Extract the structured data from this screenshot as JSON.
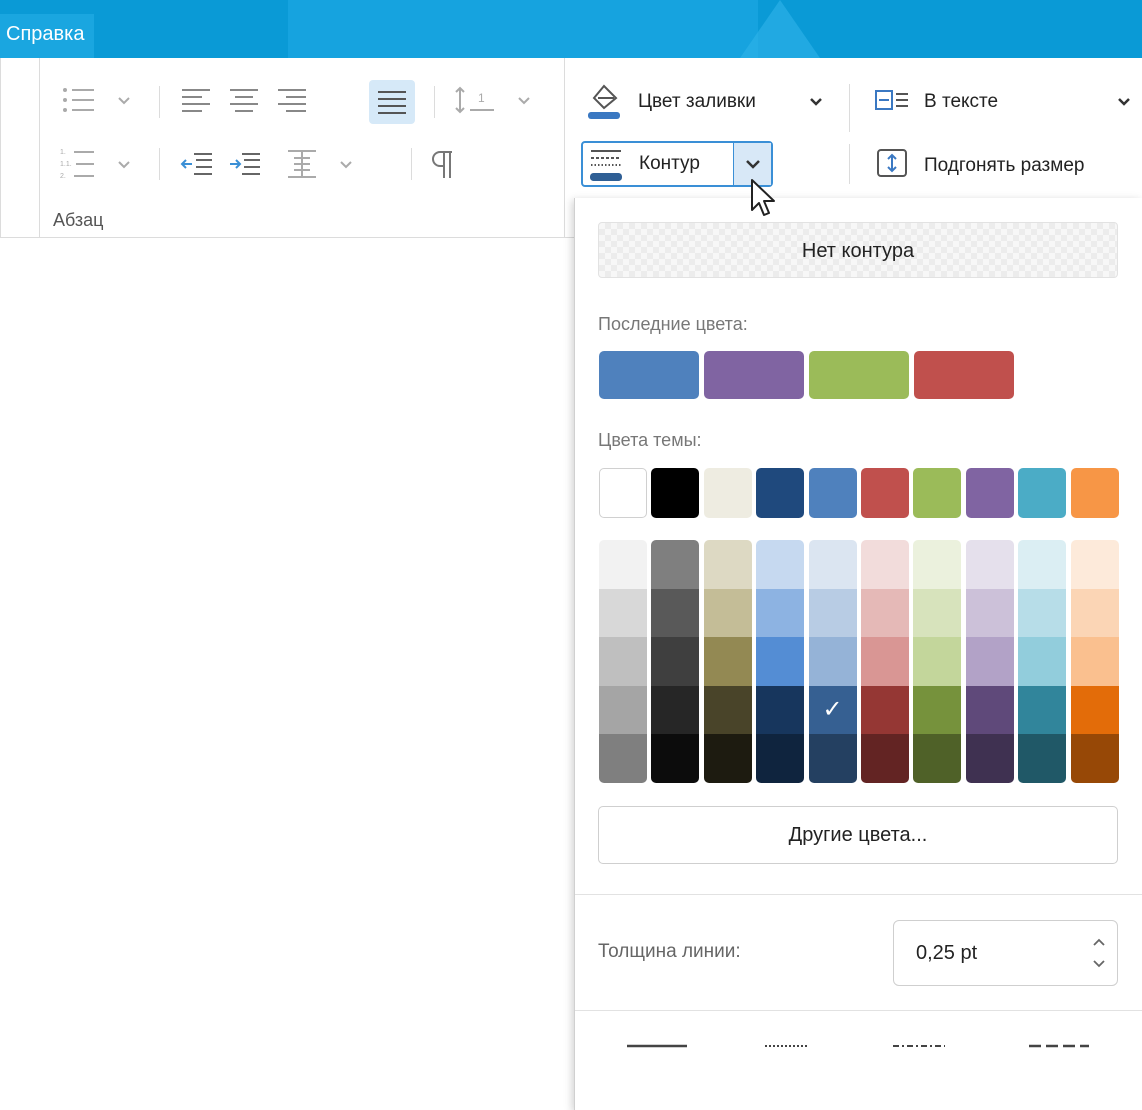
{
  "title_tab": "Справка",
  "ribbon": {
    "group_label": "Абзац",
    "fill_color_label": "Цвет заливки",
    "contour_label": "Контур",
    "in_text_label": "В тексте",
    "fit_size_label": "Подгонять размер"
  },
  "popup": {
    "no_contour_label": "Нет контура",
    "recent_colors_label": "Последние цвета:",
    "recent_colors": [
      "#4f81bd",
      "#8064a2",
      "#9bbb59",
      "#c0504d"
    ],
    "theme_colors_label": "Цвета темы:",
    "theme_colors": [
      "#ffffff",
      "#000000",
      "#eeece1",
      "#1f497d",
      "#4f81bd",
      "#c0504d",
      "#9bbb59",
      "#8064a2",
      "#4bacc6",
      "#f79646"
    ],
    "shades": [
      [
        "#f2f2f2",
        "#d8d8d8",
        "#bfbfbf",
        "#a5a5a5",
        "#7f7f7f"
      ],
      [
        "#7f7f7f",
        "#595959",
        "#3f3f3f",
        "#262626",
        "#0c0c0c"
      ],
      [
        "#ddd9c3",
        "#c4bd97",
        "#938953",
        "#494429",
        "#1d1b10"
      ],
      [
        "#c6d9f0",
        "#8db3e2",
        "#548dd4",
        "#17365d",
        "#0f243e"
      ],
      [
        "#dbe5f1",
        "#b8cce4",
        "#95b3d7",
        "#366092",
        "#244061"
      ],
      [
        "#f2dcdb",
        "#e5b9b7",
        "#d99694",
        "#953734",
        "#632423"
      ],
      [
        "#ebf1dd",
        "#d7e3bc",
        "#c3d69b",
        "#76923c",
        "#4f6128"
      ],
      [
        "#e5e0ec",
        "#ccc1d9",
        "#b2a2c7",
        "#5f497a",
        "#3f3151"
      ],
      [
        "#dbeef3",
        "#b7dde8",
        "#92cddc",
        "#31859b",
        "#205867"
      ],
      [
        "#fdeada",
        "#fbd5b5",
        "#fac08f",
        "#e36c09",
        "#974806"
      ]
    ],
    "selected_shade": "#366092",
    "other_colors_label": "Другие цвета...",
    "line_width_label": "Толщина линии:",
    "line_width_value": "0,25 pt",
    "line_styles": [
      "solid",
      "dotted",
      "dash-dot",
      "dashed"
    ]
  }
}
